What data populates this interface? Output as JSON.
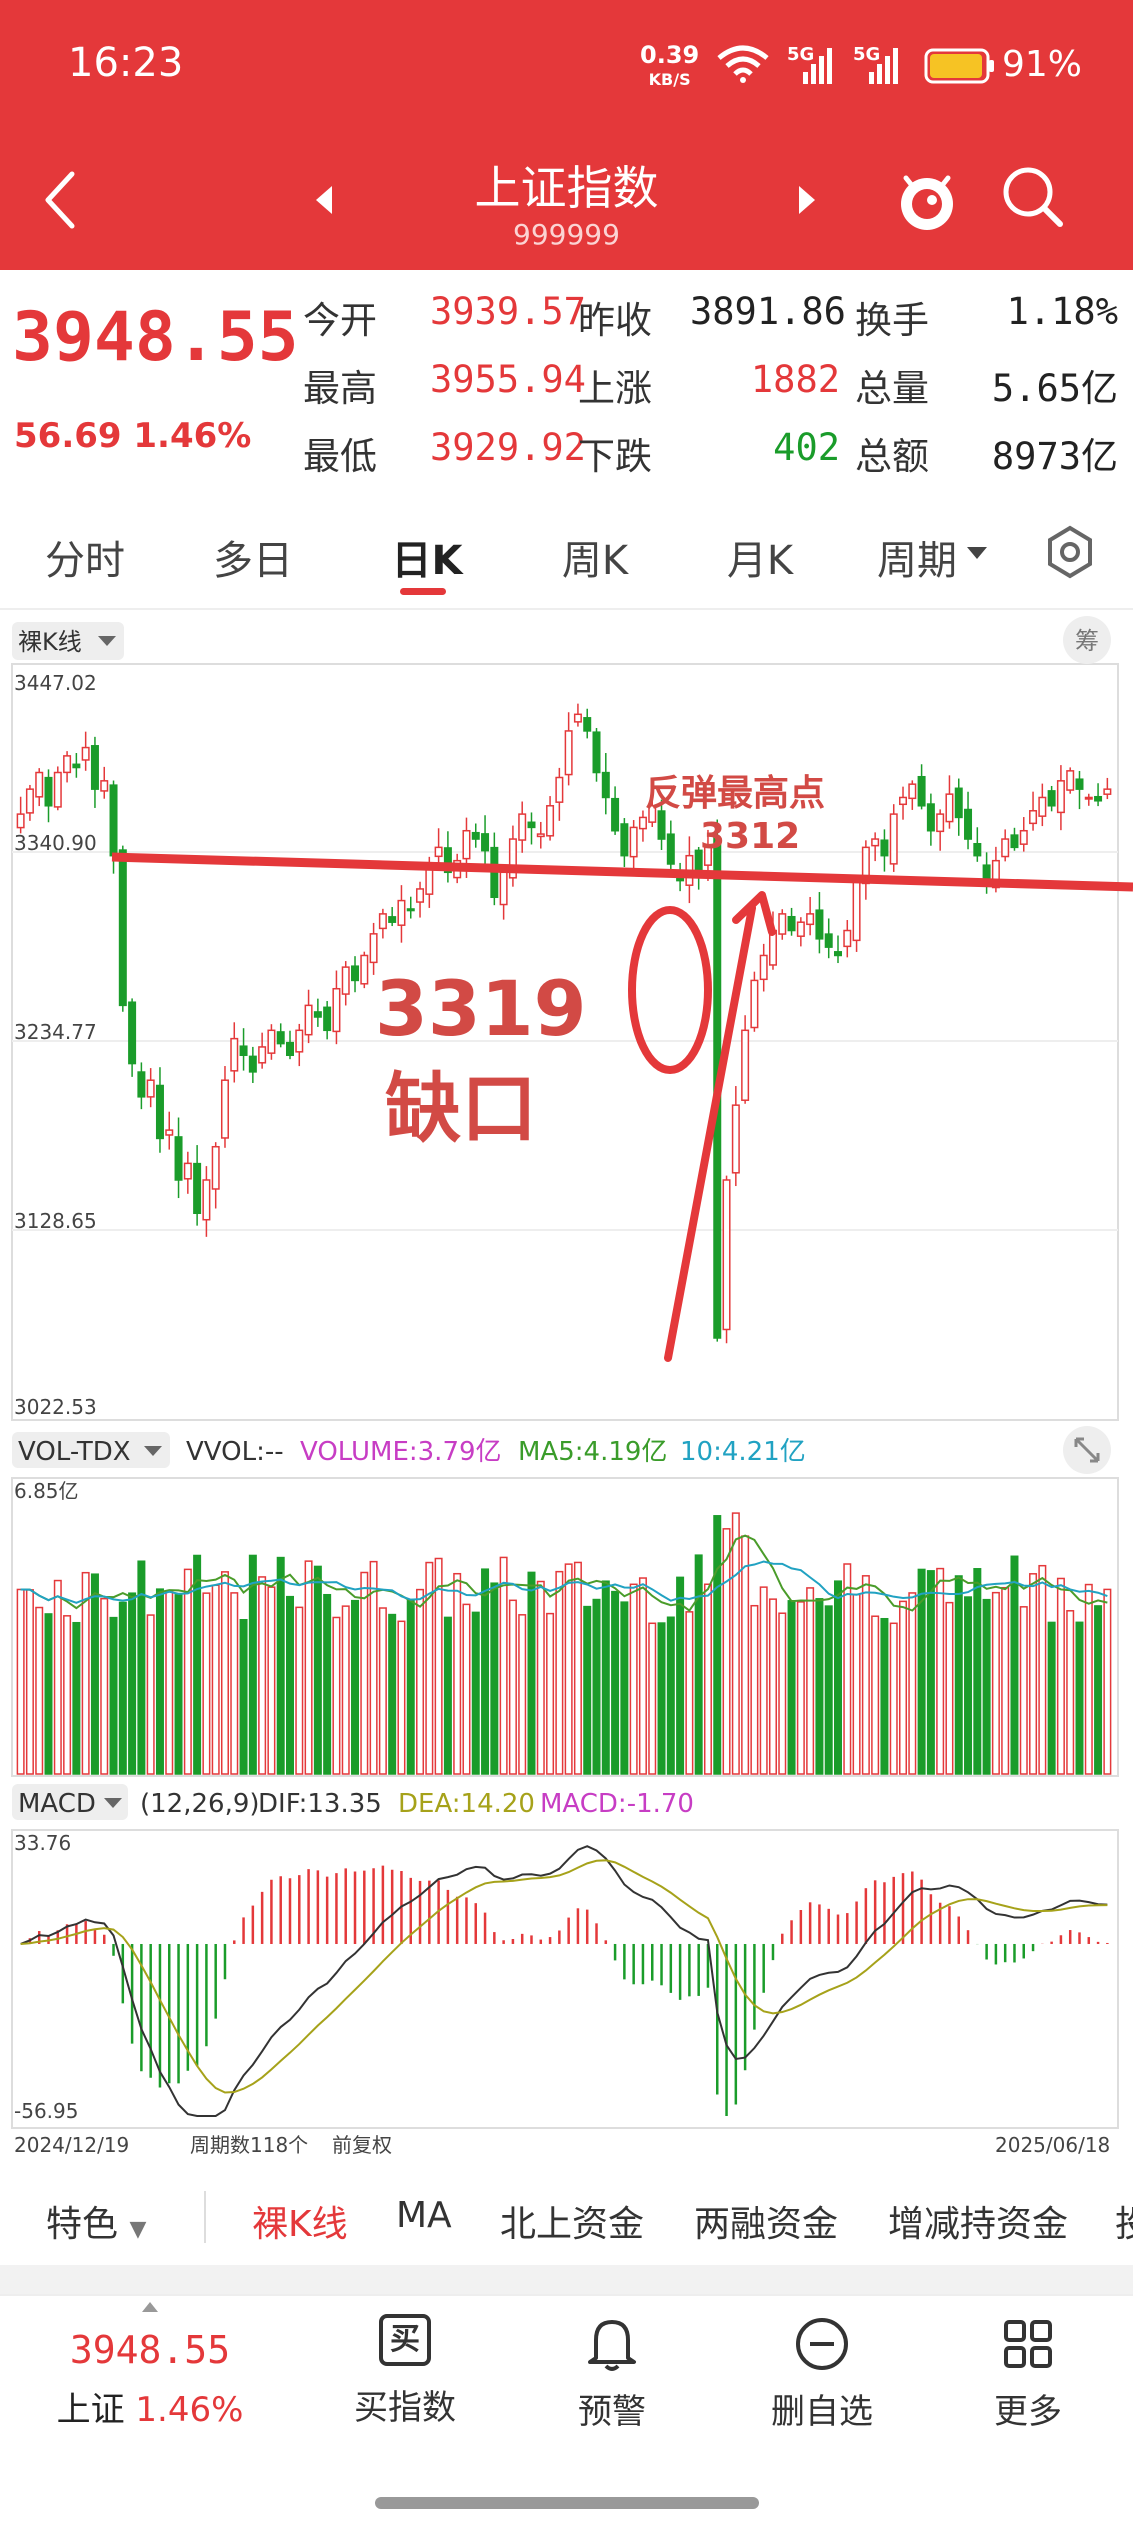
{
  "status_bar": {
    "time": "16:23",
    "net_speed": "0.39",
    "net_unit": "KB/S",
    "signal1": "5G",
    "signal2": "5G",
    "battery": "91%"
  },
  "nav": {
    "title": "上证指数",
    "code": "999999"
  },
  "quote": {
    "price": "3948.55",
    "change": "56.69",
    "change_pct": "1.46%",
    "rows": [
      {
        "l1": "今开",
        "v1": "3939.57",
        "l2": "昨收",
        "v2": "3891.86",
        "l3": "换手",
        "v3": "1.18%"
      },
      {
        "l1": "最高",
        "v1": "3955.94",
        "l2": "上涨",
        "v2": "1882",
        "l3": "总量",
        "v3": "5.65亿"
      },
      {
        "l1": "最低",
        "v1": "3929.92",
        "l2": "下跌",
        "v2": "402",
        "l3": "总额",
        "v3": "8973亿"
      }
    ]
  },
  "tabs": [
    "分时",
    "多日",
    "日K",
    "周K",
    "月K",
    "周期"
  ],
  "chart": {
    "kline_label": "裸K线",
    "chip_label": "筹",
    "vol_label": "VOL-TDX",
    "vol_legend": {
      "vvol": "VVOL:--",
      "volume": "VOLUME:3.79亿",
      "ma5": "MA5:4.19亿",
      "ma10": "10:4.21亿"
    },
    "macd_label": "MACD",
    "macd_legend": {
      "params": "(12,26,9)",
      "dif": "DIF:13.35",
      "dea": "DEA:14.20",
      "macd": "MACD:-1.70"
    },
    "price_ticks": [
      "3447.02",
      "3340.90",
      "3234.77",
      "3128.65",
      "3022.53"
    ],
    "vol_max": "6.85亿",
    "macd_max": "33.76",
    "macd_min": "-56.95",
    "date_start": "2024/12/19",
    "periods": "周期数118个",
    "adjust": "前复权",
    "date_end": "2025/06/18",
    "annotation_gap_num": "3319",
    "annotation_gap_text": "缺口",
    "annotation_high_1": "反弹最高点",
    "annotation_high_2": "3312"
  },
  "chart_data": {
    "type": "candlestick",
    "price_axis": [
      3022.53,
      3128.65,
      3234.77,
      3340.9,
      3447.02
    ],
    "macd_axis": [
      -56.95,
      33.76
    ],
    "date_range": [
      "2024/12/19",
      "2025/06/18"
    ],
    "closes": [
      3370,
      3385,
      3395,
      3375,
      3395,
      3405,
      3398,
      3410,
      3385,
      3390,
      3345,
      3255,
      3220,
      3200,
      3210,
      3175,
      3180,
      3150,
      3160,
      3130,
      3150,
      3170,
      3210,
      3235,
      3225,
      3215,
      3230,
      3240,
      3232,
      3225,
      3240,
      3255,
      3248,
      3240,
      3265,
      3278,
      3270,
      3285,
      3298,
      3310,
      3305,
      3318,
      3312,
      3325,
      3340,
      3350,
      3335,
      3342,
      3360,
      3355,
      3348,
      3320,
      3335,
      3355,
      3370,
      3362,
      3358,
      3375,
      3392,
      3420,
      3430,
      3420,
      3395,
      3380,
      3360,
      3345,
      3362,
      3368,
      3375,
      3355,
      3340,
      3330,
      3345,
      3335,
      3350,
      3055,
      3150,
      3195,
      3240,
      3270,
      3285,
      3300,
      3310,
      3300,
      3305,
      3310,
      3295,
      3290,
      3285,
      3300,
      3330,
      3350,
      3355,
      3345,
      3370,
      3380,
      3388,
      3375,
      3360,
      3370,
      3382,
      3368,
      3355,
      3345,
      3330,
      3342,
      3355,
      3350,
      3360,
      3372,
      3380,
      3375,
      3390,
      3396,
      3385,
      3380,
      3378,
      3385
    ]
  },
  "features": [
    "特色",
    "裸K线",
    "MA",
    "北上资金",
    "两融资金",
    "增减持资金",
    "投"
  ],
  "bottom": {
    "price": "3948.55",
    "name": "上证",
    "pct": "1.46%",
    "buy": "买指数",
    "buy_icon": "买",
    "alert": "预警",
    "remove": "删自选",
    "more": "更多"
  }
}
